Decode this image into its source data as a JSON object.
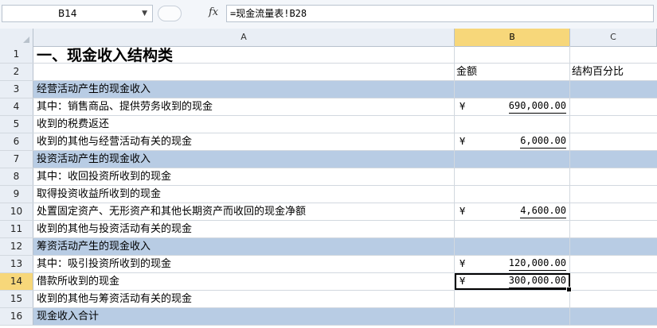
{
  "formula_bar": {
    "name_box": "B14",
    "fx_label": "fx",
    "formula": "=现金流量表!B28"
  },
  "columns": [
    "A",
    "B",
    "C"
  ],
  "selected_column": "B",
  "active_row": "14",
  "rows": [
    {
      "num": "1",
      "a": "一、现金收入结构类",
      "b": "",
      "c": "",
      "band": false,
      "title": true
    },
    {
      "num": "2",
      "a": "",
      "b": "金额",
      "c": "结构百分比",
      "band": false
    },
    {
      "num": "3",
      "a": "经营活动产生的现金收入",
      "b": "",
      "c": "",
      "band": true
    },
    {
      "num": "4",
      "a": "其中：销售商品、提供劳务收到的现金",
      "b": "",
      "c": "",
      "band": false,
      "money": {
        "cur": "¥",
        "amt": "690,000.00"
      }
    },
    {
      "num": "5",
      "a": "收到的税费返还",
      "b": "",
      "c": "",
      "band": false
    },
    {
      "num": "6",
      "a": "收到的其他与经营活动有关的现金",
      "b": "",
      "c": "",
      "band": false,
      "money": {
        "cur": "¥",
        "amt": "6,000.00"
      }
    },
    {
      "num": "7",
      "a": "投资活动产生的现金收入",
      "b": "",
      "c": "",
      "band": true
    },
    {
      "num": "8",
      "a": "其中：收回投资所收到的现金",
      "b": "",
      "c": "",
      "band": false
    },
    {
      "num": "9",
      "a": "取得投资收益所收到的现金",
      "b": "",
      "c": "",
      "band": false
    },
    {
      "num": "10",
      "a": "处置固定资产、无形资产和其他长期资产而收回的现金净额",
      "b": "",
      "c": "",
      "band": false,
      "money": {
        "cur": "¥",
        "amt": "4,600.00"
      }
    },
    {
      "num": "11",
      "a": "收到的其他与投资活动有关的现金",
      "b": "",
      "c": "",
      "band": false
    },
    {
      "num": "12",
      "a": "筹资活动产生的现金收入",
      "b": "",
      "c": "",
      "band": true
    },
    {
      "num": "13",
      "a": "其中：吸引投资所收到的现金",
      "b": "",
      "c": "",
      "band": false,
      "money": {
        "cur": "¥",
        "amt": "120,000.00"
      }
    },
    {
      "num": "14",
      "a": "借款所收到的现金",
      "b": "",
      "c": "",
      "band": false,
      "money": {
        "cur": "¥",
        "amt": "300,000.00"
      },
      "active": true
    },
    {
      "num": "15",
      "a": "收到的其他与筹资活动有关的现金",
      "b": "",
      "c": "",
      "band": false
    },
    {
      "num": "16",
      "a": "现金收入合计",
      "b": "",
      "c": "",
      "band": true
    }
  ]
}
